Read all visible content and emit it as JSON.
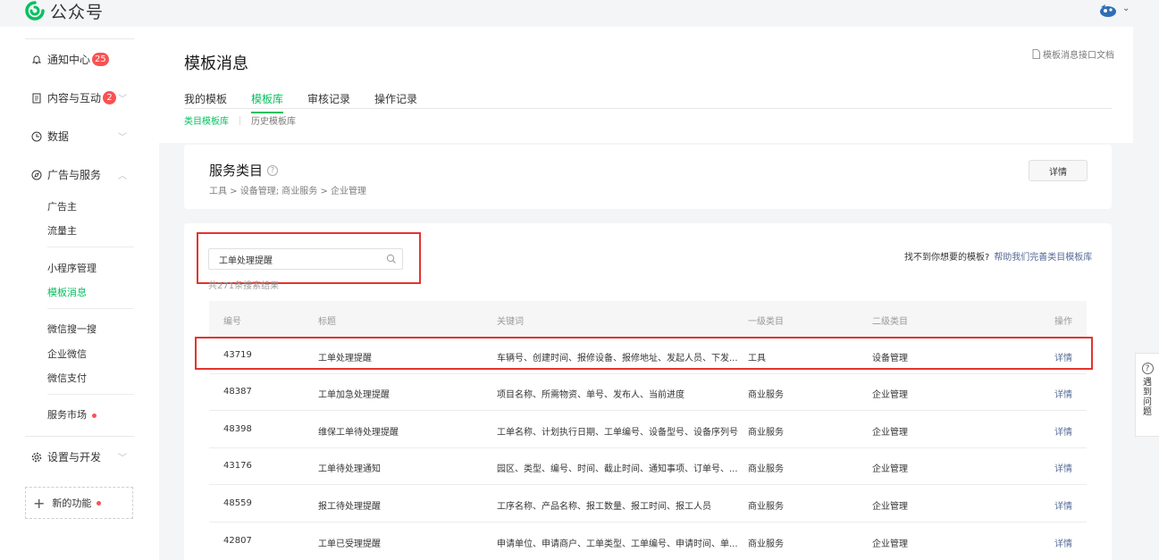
{
  "brand": {
    "name": "公众号",
    "accent": "#07c160"
  },
  "sidebar": {
    "notifications": {
      "label": "通知中心",
      "badge": "25"
    },
    "content": {
      "label": "内容与互动",
      "badge": "2"
    },
    "data": {
      "label": "数据"
    },
    "ads": {
      "label": "广告与服务",
      "items": [
        "广告主",
        "流量主",
        "小程序管理",
        "模板消息",
        "微信搜一搜",
        "企业微信",
        "微信支付",
        "服务市场"
      ]
    },
    "settings": {
      "label": "设置与开发"
    },
    "new_features": "新的功能"
  },
  "page": {
    "title": "模板消息",
    "doc_link": "模板消息接口文档",
    "tabs": [
      "我的模板",
      "模板库",
      "审核记录",
      "操作记录"
    ],
    "subtabs": [
      "类目模板库",
      "历史模板库"
    ]
  },
  "category": {
    "title": "服务类目",
    "path": "工具 > 设备管理; 商业服务 > 企业管理",
    "detail_button": "详情"
  },
  "search": {
    "value": "工单处理提醒",
    "result_count": "共271条搜索结果",
    "help_text": "找不到你想要的模板?",
    "help_link": "帮助我们完善类目模板库"
  },
  "table": {
    "headers": [
      "编号",
      "标题",
      "关键词",
      "一级类目",
      "二级类目",
      "操作"
    ],
    "rows": [
      {
        "id": "43719",
        "title": "工单处理提醒",
        "keywords": "车辆号、创建时间、报修设备、报修地址、发起人员、下发...",
        "cat1": "工具",
        "cat2": "设备管理",
        "op": "详情"
      },
      {
        "id": "48387",
        "title": "工单加急处理提醒",
        "keywords": "项目名称、所需物资、单号、发布人、当前进度",
        "cat1": "商业服务",
        "cat2": "企业管理",
        "op": "详情"
      },
      {
        "id": "48398",
        "title": "维保工单待处理提醒",
        "keywords": "工单名称、计划执行日期、工单编号、设备型号、设备序列号",
        "cat1": "商业服务",
        "cat2": "企业管理",
        "op": "详情"
      },
      {
        "id": "43176",
        "title": "工单待处理通知",
        "keywords": "园区、类型、编号、时间、截止时间、通知事项、订单号、...",
        "cat1": "商业服务",
        "cat2": "企业管理",
        "op": "详情"
      },
      {
        "id": "48559",
        "title": "报工待处理提醒",
        "keywords": "工序名称、产品名称、报工数量、报工时间、报工人员",
        "cat1": "商业服务",
        "cat2": "企业管理",
        "op": "详情"
      },
      {
        "id": "42807",
        "title": "工单已受理提醒",
        "keywords": "申请单位、申请商户、工单类型、工单编号、申请时间、单...",
        "cat1": "商业服务",
        "cat2": "企业管理",
        "op": "详情"
      }
    ]
  },
  "float_help": {
    "label": "遇到问题"
  }
}
